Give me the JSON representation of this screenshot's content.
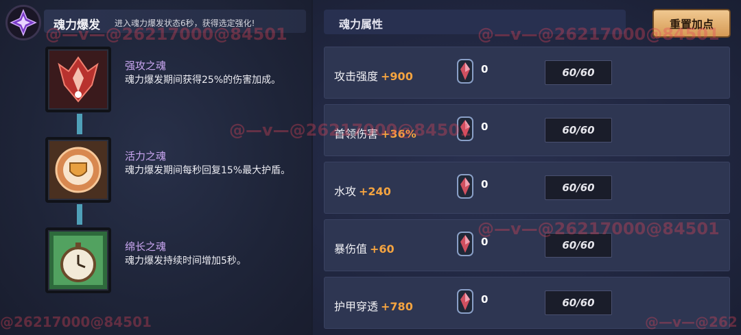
{
  "burst": {
    "title": "魂力爆发",
    "description": "进入魂力爆发状态6秒，获得选定强化!"
  },
  "skills": [
    {
      "name": "强攻之魂",
      "desc": "魂力爆发期间获得25%的伤害加成。",
      "icon": "red-claw-icon"
    },
    {
      "name": "活力之魂",
      "desc": "魂力爆发期间每秒回复15%最大护盾。",
      "icon": "orange-shield-icon"
    },
    {
      "name": "绵长之魂",
      "desc": "魂力爆发持续时间增加5秒。",
      "icon": "green-stopwatch-icon"
    }
  ],
  "attributes": {
    "title": "魂力属性",
    "reset_label": "重置加点",
    "rows": [
      {
        "label": "攻击强度",
        "bonus": "+900",
        "gems": "0",
        "level": "60/60"
      },
      {
        "label": "首领伤害",
        "bonus": "+36%",
        "gems": "0",
        "level": "60/60"
      },
      {
        "label": "水攻",
        "bonus": "+240",
        "gems": "0",
        "level": "60/60"
      },
      {
        "label": "暴伤值",
        "bonus": "+60",
        "gems": "0",
        "level": "60/60"
      },
      {
        "label": "护甲穿透",
        "bonus": "+780",
        "gems": "0",
        "level": "60/60"
      }
    ]
  },
  "watermarks": {
    "a": "@—v—@26217000@84501",
    "b": "@—v—@26217000@84501",
    "c": "@—v—@26217000@84501",
    "d": "@—v—@26217000@84501",
    "e": "@26217000@84501",
    "f": "@—v—@262"
  },
  "colors": {
    "bonus": "#f5a440",
    "skill_name": "#c9a6f0",
    "reset_button": "#e8b070"
  }
}
